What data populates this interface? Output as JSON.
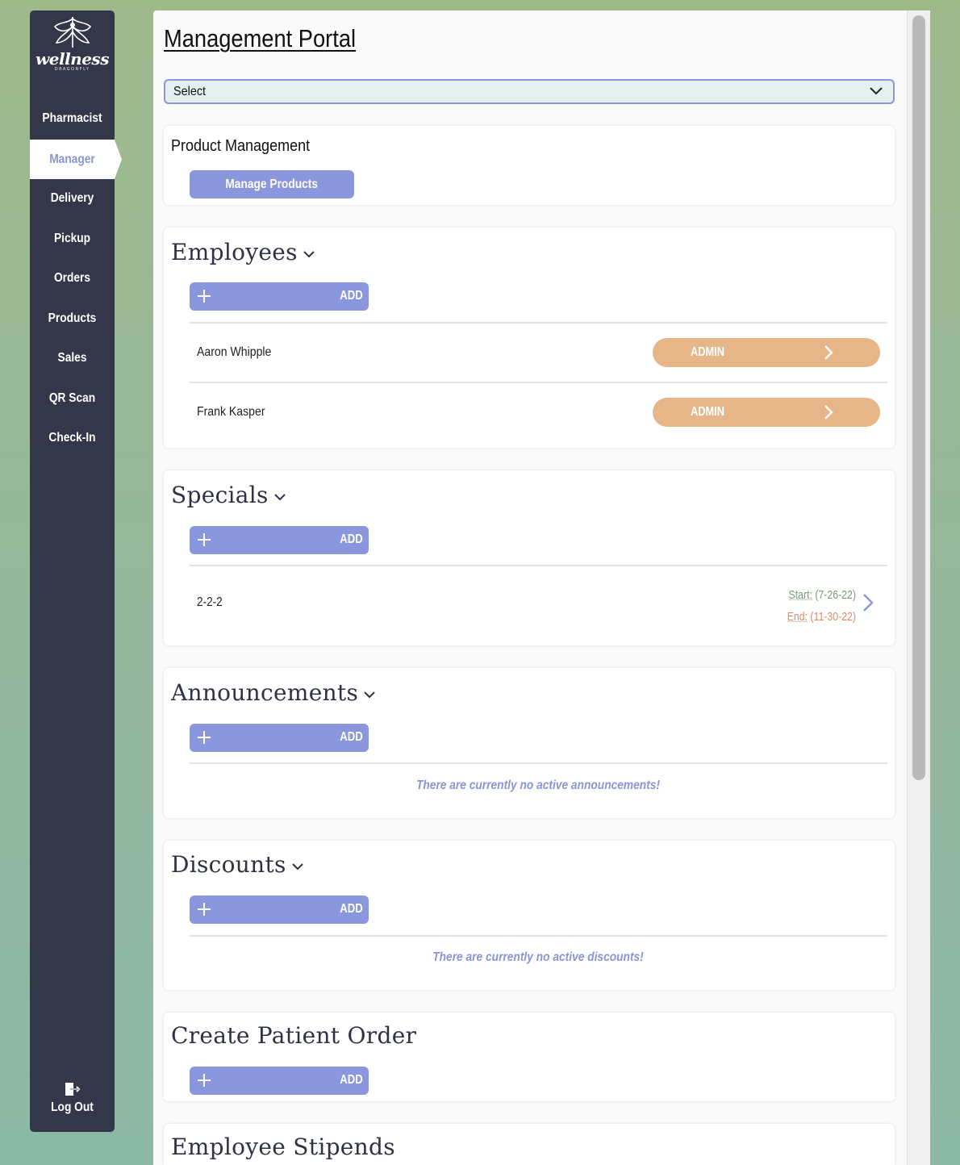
{
  "brand": {
    "name": "wellness",
    "sub": "DRAGONFLY"
  },
  "sidebar": {
    "items": [
      {
        "label": "Pharmacist"
      },
      {
        "label": "Manager",
        "active": true
      },
      {
        "label": "Delivery"
      },
      {
        "label": "Pickup"
      },
      {
        "label": "Orders"
      },
      {
        "label": "Products"
      },
      {
        "label": "Sales"
      },
      {
        "label": "QR Scan"
      },
      {
        "label": "Check-In"
      }
    ],
    "logout_label": "Log Out"
  },
  "page": {
    "title": "Management Portal",
    "select_value": "Select"
  },
  "product_management": {
    "title": "Product Management",
    "button": "Manage Products"
  },
  "employees": {
    "title": "Employees",
    "add_label": "ADD",
    "rows": [
      {
        "name": "Aaron Whipple",
        "role": "ADMIN"
      },
      {
        "name": "Frank Kasper",
        "role": "ADMIN"
      }
    ]
  },
  "specials": {
    "title": "Specials",
    "add_label": "ADD",
    "rows": [
      {
        "name": "2-2-2",
        "start_label": "Start:",
        "start": "(7-26-22)",
        "end_label": "End:",
        "end": "(11-30-22)"
      }
    ]
  },
  "announcements": {
    "title": "Announcements",
    "add_label": "ADD",
    "empty": "There are currently no active announcements!"
  },
  "discounts": {
    "title": "Discounts",
    "add_label": "ADD",
    "empty": "There are currently no active discounts!"
  },
  "create_patient_order": {
    "title": "Create Patient Order",
    "add_label": "ADD"
  },
  "employee_stipends": {
    "title": "Employee Stipends"
  },
  "colors": {
    "sidebar": "#343649",
    "accent": "#8b97dc",
    "role_pill": "#e6b689",
    "start_date": "#7a9a78",
    "end_date": "#e08a6b"
  }
}
